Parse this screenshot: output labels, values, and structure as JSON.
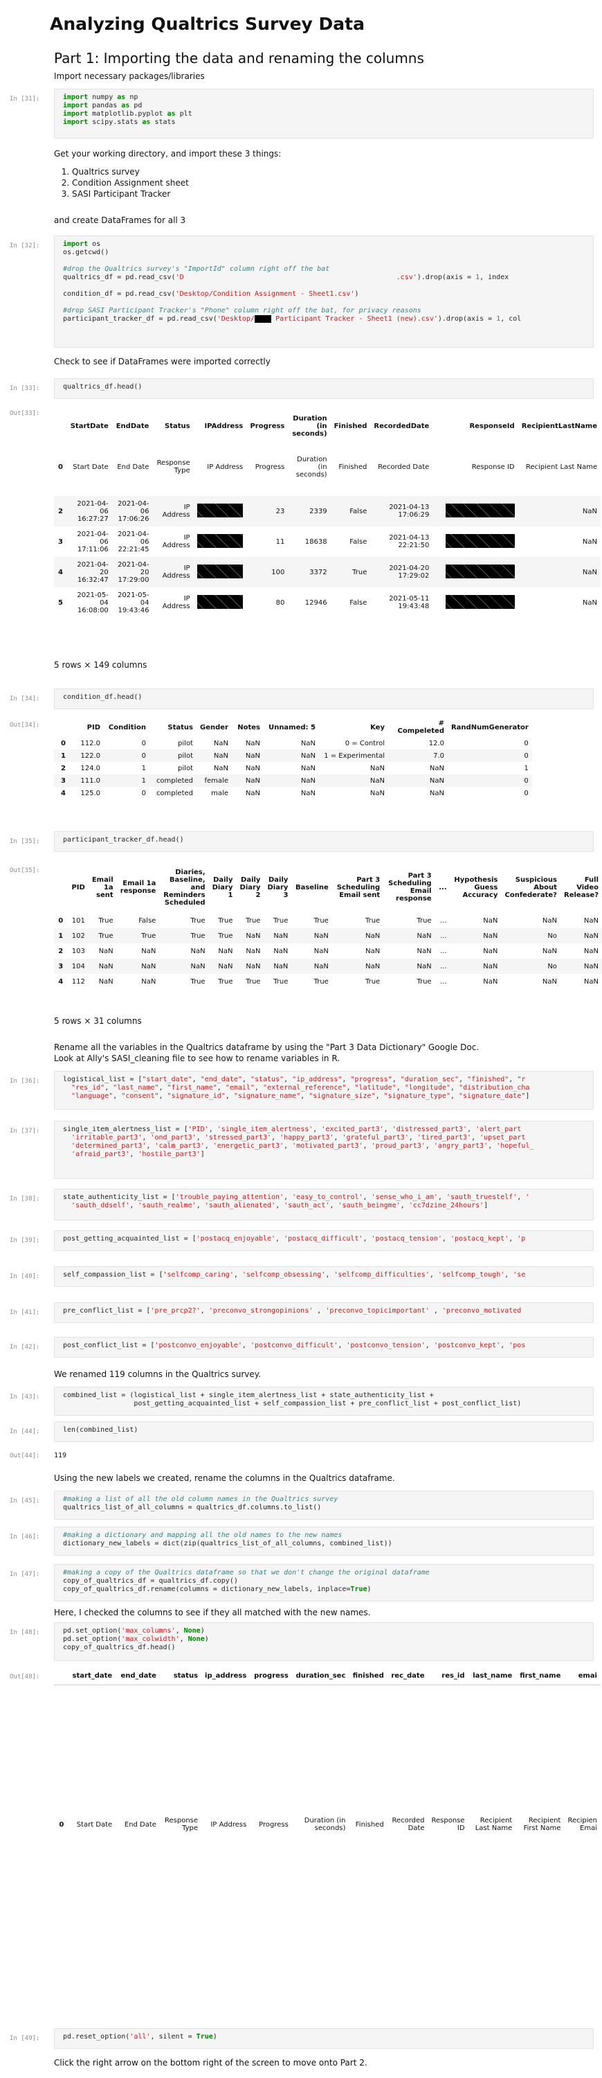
{
  "title": "Analyzing Qualtrics Survey Data",
  "part1_heading": "Part 1: Importing the data and renaming the columns",
  "md_import": "Import necessary packages/libraries",
  "prompt_31": "In [31]:",
  "prompt_32": "In [32]:",
  "prompt_33": "In [33]:",
  "out_33": "Out[33]:",
  "prompt_34": "In [34]:",
  "out_34": "Out[34]:",
  "prompt_35": "In [35]:",
  "out_35": "Out[35]:",
  "prompt_36": "In [36]:",
  "prompt_37": "In [37]:",
  "prompt_38": "In [38]:",
  "prompt_39": "In [39]:",
  "prompt_40": "In [40]:",
  "prompt_41": "In [41]:",
  "prompt_42": "In [42]:",
  "prompt_43": "In [43]:",
  "prompt_44": "In [44]:",
  "out_44": "Out[44]:",
  "prompt_45": "In [45]:",
  "prompt_46": "In [46]:",
  "prompt_47": "In [47]:",
  "prompt_48": "In [48]:",
  "out_48": "Out[48]:",
  "prompt_49": "In [49]:",
  "md_workdir": "Get your working directory, and import these 3 things:",
  "list_items": [
    "Qualtrics survey",
    "Condition Assignment sheet",
    "SASI Participant Tracker"
  ],
  "md_dataframes": "and create DataFrames for all 3",
  "md_check": "Check to see if DataFrames were imported correctly",
  "code_head_q": "qualtrics_df.head()",
  "code_head_c": "condition_df.head()",
  "code_head_p": "participant_tracker_df.head()",
  "rows_cols_1": "5 rows × 149 columns",
  "rows_cols_3": "5 rows × 31 columns",
  "md_rename_1": "Rename all the variables in the Qualtrics dataframe by using the \"Part 3 Data Dictionary\" Google Doc.",
  "md_rename_2": "Look at Ally's SASI_cleaning file to see how to rename variables in R.",
  "md_renamed": "We renamed 119 columns in the Qualtrics survey.",
  "code_len": "len(combined_list)",
  "out_len": "119",
  "md_newlabels": "Using the new labels we created, rename the columns in the Qualtrics dataframe.",
  "md_checked": "Here, I checked the columns to see if they all matched with the new names.",
  "md_next": "Click the right arrow on the bottom right of the screen to move onto Part 2.",
  "q_table": {
    "headers": [
      "",
      "StartDate",
      "EndDate",
      "Status",
      "IPAddress",
      "Progress",
      "Duration (in seconds)",
      "Finished",
      "RecordedDate",
      "",
      "ResponseId",
      "RecipientLastName"
    ],
    "label_row": [
      "0",
      "Start Date",
      "End Date",
      "Response Type",
      "IP Address",
      "Progress",
      "Duration (in seconds)",
      "Finished",
      "Recorded Date",
      "",
      "Response ID",
      "Recipient Last Name"
    ],
    "rows": [
      [
        "2",
        "2021-04-06 16:27:27",
        "2021-04-06 17:06:26",
        "IP Address",
        "",
        "23",
        "2339",
        "False",
        "2021-04-13 17:06:29",
        "",
        "",
        "NaN"
      ],
      [
        "3",
        "2021-04-06 17:11:06",
        "2021-04-06 22:21:45",
        "IP Address",
        "",
        "11",
        "18638",
        "False",
        "2021-04-13 22:21:50",
        "",
        "",
        "NaN"
      ],
      [
        "4",
        "2021-04-20 16:32:47",
        "2021-04-20 17:29:00",
        "IP Address",
        "",
        "100",
        "3372",
        "True",
        "2021-04-20 17:29:02",
        "",
        "",
        "NaN"
      ],
      [
        "5",
        "2021-05-04 16:08:00",
        "2021-05-04 19:43:46",
        "IP Address",
        "",
        "80",
        "12946",
        "False",
        "2021-05-11 19:43:48",
        "",
        "",
        "NaN"
      ]
    ]
  },
  "c_table": {
    "headers": [
      "",
      "PID",
      "Condition",
      "Status",
      "Gender",
      "Notes",
      "Unnamed: 5",
      "Key",
      "# Compeleted",
      "RandNumGenerator"
    ],
    "rows": [
      [
        "0",
        "112.0",
        "0",
        "pilot",
        "NaN",
        "NaN",
        "NaN",
        "0 = Control",
        "12.0",
        "0"
      ],
      [
        "1",
        "122.0",
        "0",
        "pilot",
        "NaN",
        "NaN",
        "NaN",
        "1 = Experimental",
        "7.0",
        "0"
      ],
      [
        "2",
        "124.0",
        "1",
        "pilot",
        "NaN",
        "NaN",
        "NaN",
        "NaN",
        "NaN",
        "1"
      ],
      [
        "3",
        "111.0",
        "1",
        "completed",
        "female",
        "NaN",
        "NaN",
        "NaN",
        "NaN",
        "0"
      ],
      [
        "4",
        "125.0",
        "0",
        "completed",
        "male",
        "NaN",
        "NaN",
        "NaN",
        "NaN",
        "0"
      ]
    ]
  },
  "p_table": {
    "headers": [
      "",
      "PID",
      "Email 1a sent",
      "Email 1a response",
      "Diaries, Baseline, and Reminders Scheduled",
      "Daily Diary 1",
      "Daily Diary 2",
      "Daily Diary 3",
      "Baseline",
      "Part 3 Scheduling Email sent",
      "Part 3 Scheduling Email response",
      "...",
      "Hypothesis Guess Accuracy",
      "Suspicious About Confederate?",
      "Full Video Release?"
    ],
    "rows": [
      [
        "0",
        "101",
        "True",
        "False",
        "True",
        "True",
        "True",
        "True",
        "True",
        "True",
        "True",
        "...",
        "NaN",
        "NaN",
        "NaN"
      ],
      [
        "1",
        "102",
        "True",
        "True",
        "True",
        "True",
        "NaN",
        "NaN",
        "NaN",
        "NaN",
        "NaN",
        "...",
        "NaN",
        "No",
        "NaN"
      ],
      [
        "2",
        "103",
        "NaN",
        "NaN",
        "NaN",
        "NaN",
        "NaN",
        "NaN",
        "NaN",
        "NaN",
        "NaN",
        "...",
        "NaN",
        "NaN",
        "NaN"
      ],
      [
        "3",
        "104",
        "NaN",
        "NaN",
        "NaN",
        "NaN",
        "NaN",
        "NaN",
        "NaN",
        "NaN",
        "NaN",
        "...",
        "NaN",
        "No",
        "NaN"
      ],
      [
        "4",
        "112",
        "NaN",
        "NaN",
        "True",
        "True",
        "True",
        "True",
        "True",
        "True",
        "True",
        "...",
        "NaN",
        "NaN",
        "NaN"
      ]
    ]
  },
  "final_table": {
    "headers": [
      "",
      "start_date",
      "end_date",
      "status",
      "ip_address",
      "progress",
      "duration_sec",
      "finished",
      "rec_date",
      "res_id",
      "last_name",
      "first_name",
      "emai"
    ],
    "row0": [
      "0",
      "Start Date",
      "End Date",
      "Response Type",
      "IP Address",
      "Progress",
      "Duration (in seconds)",
      "Finished",
      "Recorded Date",
      "Response ID",
      "Recipient Last Name",
      "Recipient First Name",
      "Recipien Emai"
    ]
  },
  "code_reset": "pd.reset_option('all', silent = True)"
}
